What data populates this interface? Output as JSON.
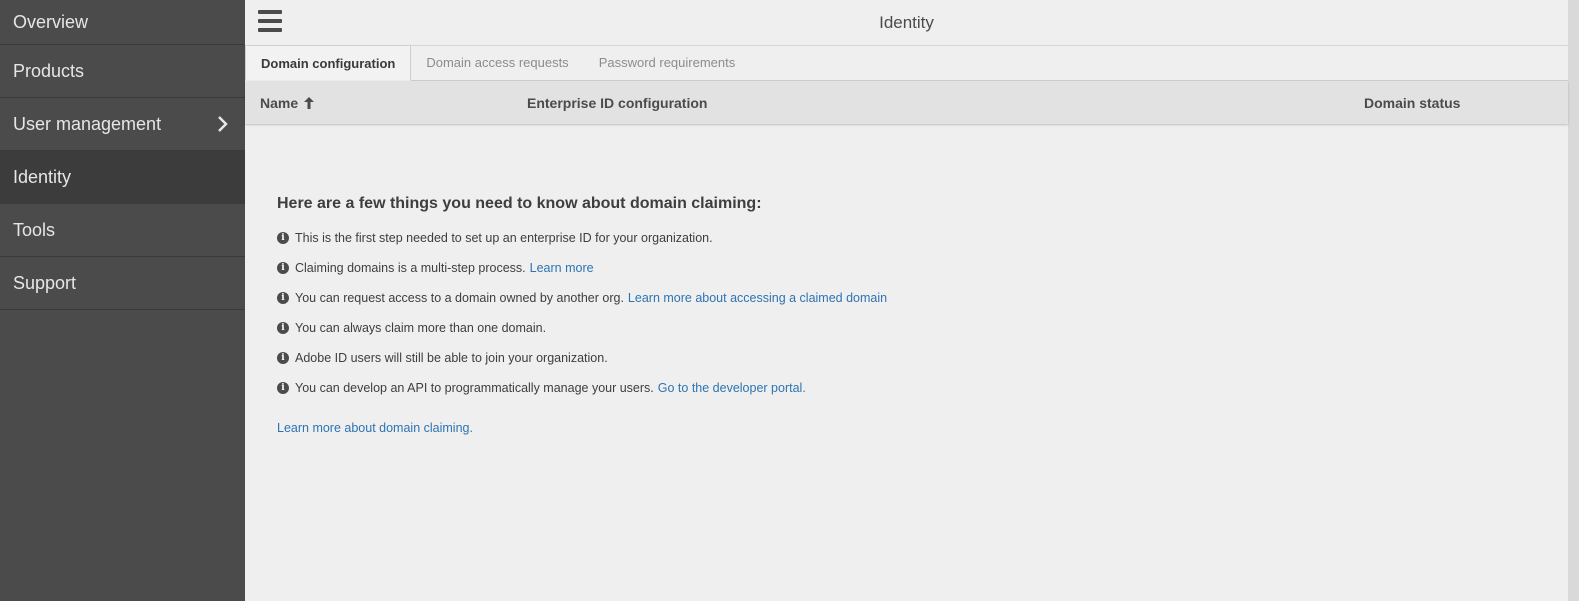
{
  "sidebar": {
    "items": [
      {
        "label": "Overview"
      },
      {
        "label": "Products"
      },
      {
        "label": "User management"
      },
      {
        "label": "Identity"
      },
      {
        "label": "Tools"
      },
      {
        "label": "Support"
      }
    ]
  },
  "header": {
    "title": "Identity"
  },
  "tabs": [
    {
      "label": "Domain configuration",
      "active": true
    },
    {
      "label": "Domain access requests",
      "active": false
    },
    {
      "label": "Password requirements",
      "active": false
    }
  ],
  "table": {
    "columns": [
      {
        "label": "Name",
        "sort": "ascending"
      },
      {
        "label": "Enterprise ID configuration"
      },
      {
        "label": "Domain status"
      }
    ]
  },
  "info": {
    "heading": "Here are a few things you need to know about domain claiming:",
    "items": [
      {
        "text": "This is the first step needed to set up an enterprise ID for your organization.",
        "link": ""
      },
      {
        "text": "Claiming domains is a multi-step process.",
        "link": "Learn more"
      },
      {
        "text": "You can request access to a domain owned by another org.",
        "link": "Learn more about accessing a claimed domain"
      },
      {
        "text": "You can always claim more than one domain.",
        "link": ""
      },
      {
        "text": "Adobe ID users will still be able to join your organization.",
        "link": ""
      },
      {
        "text": "You can develop an API to programmatically manage your users.",
        "link": "Go to the developer portal."
      }
    ],
    "info_icon": "i",
    "bottom_link": "Learn more about domain claiming."
  },
  "colors": {
    "sidebar_bg": "#4b4b4b",
    "sidebar_active": "#3c3c3c",
    "link": "#2d74b3",
    "page_bg": "#efefef"
  }
}
